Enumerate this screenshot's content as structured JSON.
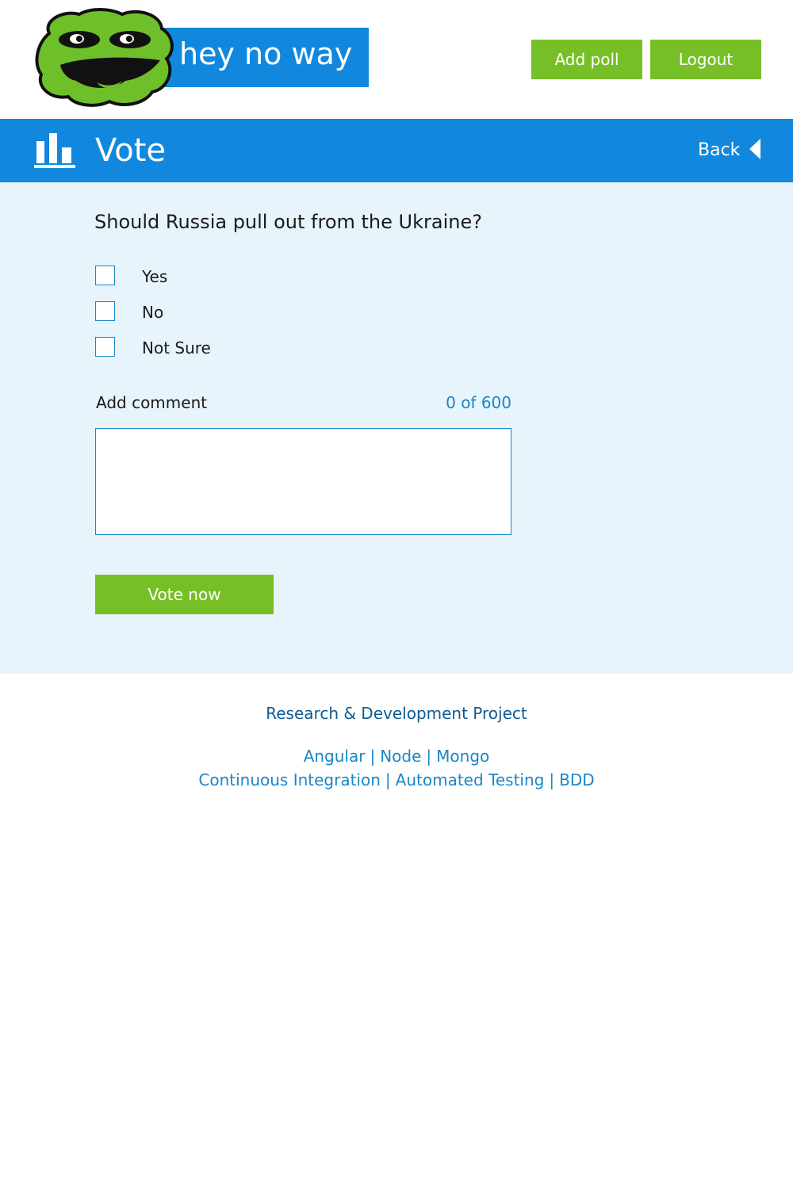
{
  "header": {
    "site_name": "hey no way",
    "buttons": {
      "add_poll": "Add poll",
      "logout": "Logout"
    }
  },
  "title_bar": {
    "title": "Vote",
    "back_label": "Back",
    "icon": "bar-chart-icon"
  },
  "poll": {
    "question": "Should Russia pull out from the Ukraine?",
    "options": [
      {
        "label": "Yes",
        "checked": false
      },
      {
        "label": "No",
        "checked": false
      },
      {
        "label": "Not Sure",
        "checked": false
      }
    ],
    "comment_label": "Add comment",
    "char_count": "0 of 600",
    "comment_value": "",
    "vote_button": "Vote now"
  },
  "footer": {
    "title": "Research & Development Project",
    "line1": [
      "Angular",
      "Node",
      "Mongo"
    ],
    "line2": [
      "Continuous Integration",
      "Automated Testing",
      "BDD"
    ],
    "separator": "|"
  },
  "colors": {
    "primary_blue": "#1188dd",
    "accent_green": "#77bf27",
    "content_bg": "#e7f4fc",
    "link_blue": "#1a86c7",
    "footer_title": "#0f5a91"
  }
}
